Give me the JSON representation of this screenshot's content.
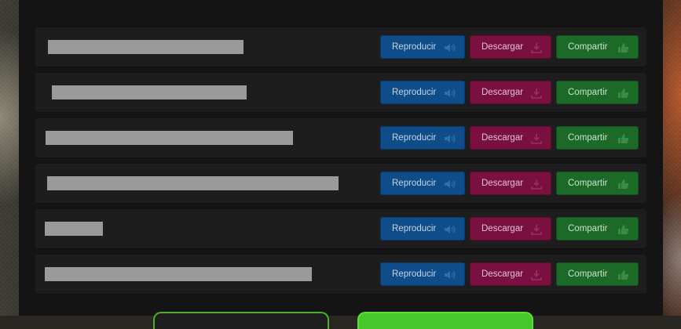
{
  "labels": {
    "play": "Reproducir",
    "download": "Descargar",
    "share": "Compartir"
  },
  "icons": {
    "play": "speaker-icon",
    "download": "download-icon",
    "share": "thumbs-up-icon"
  },
  "colors": {
    "play": "#0e4d8a",
    "download": "#7a1040",
    "share": "#1c6a28",
    "title_placeholder": "#9a9a9a"
  },
  "rows": [
    {
      "id": "row-1"
    },
    {
      "id": "row-2"
    },
    {
      "id": "row-3"
    },
    {
      "id": "row-4"
    },
    {
      "id": "row-5"
    },
    {
      "id": "row-6"
    }
  ]
}
